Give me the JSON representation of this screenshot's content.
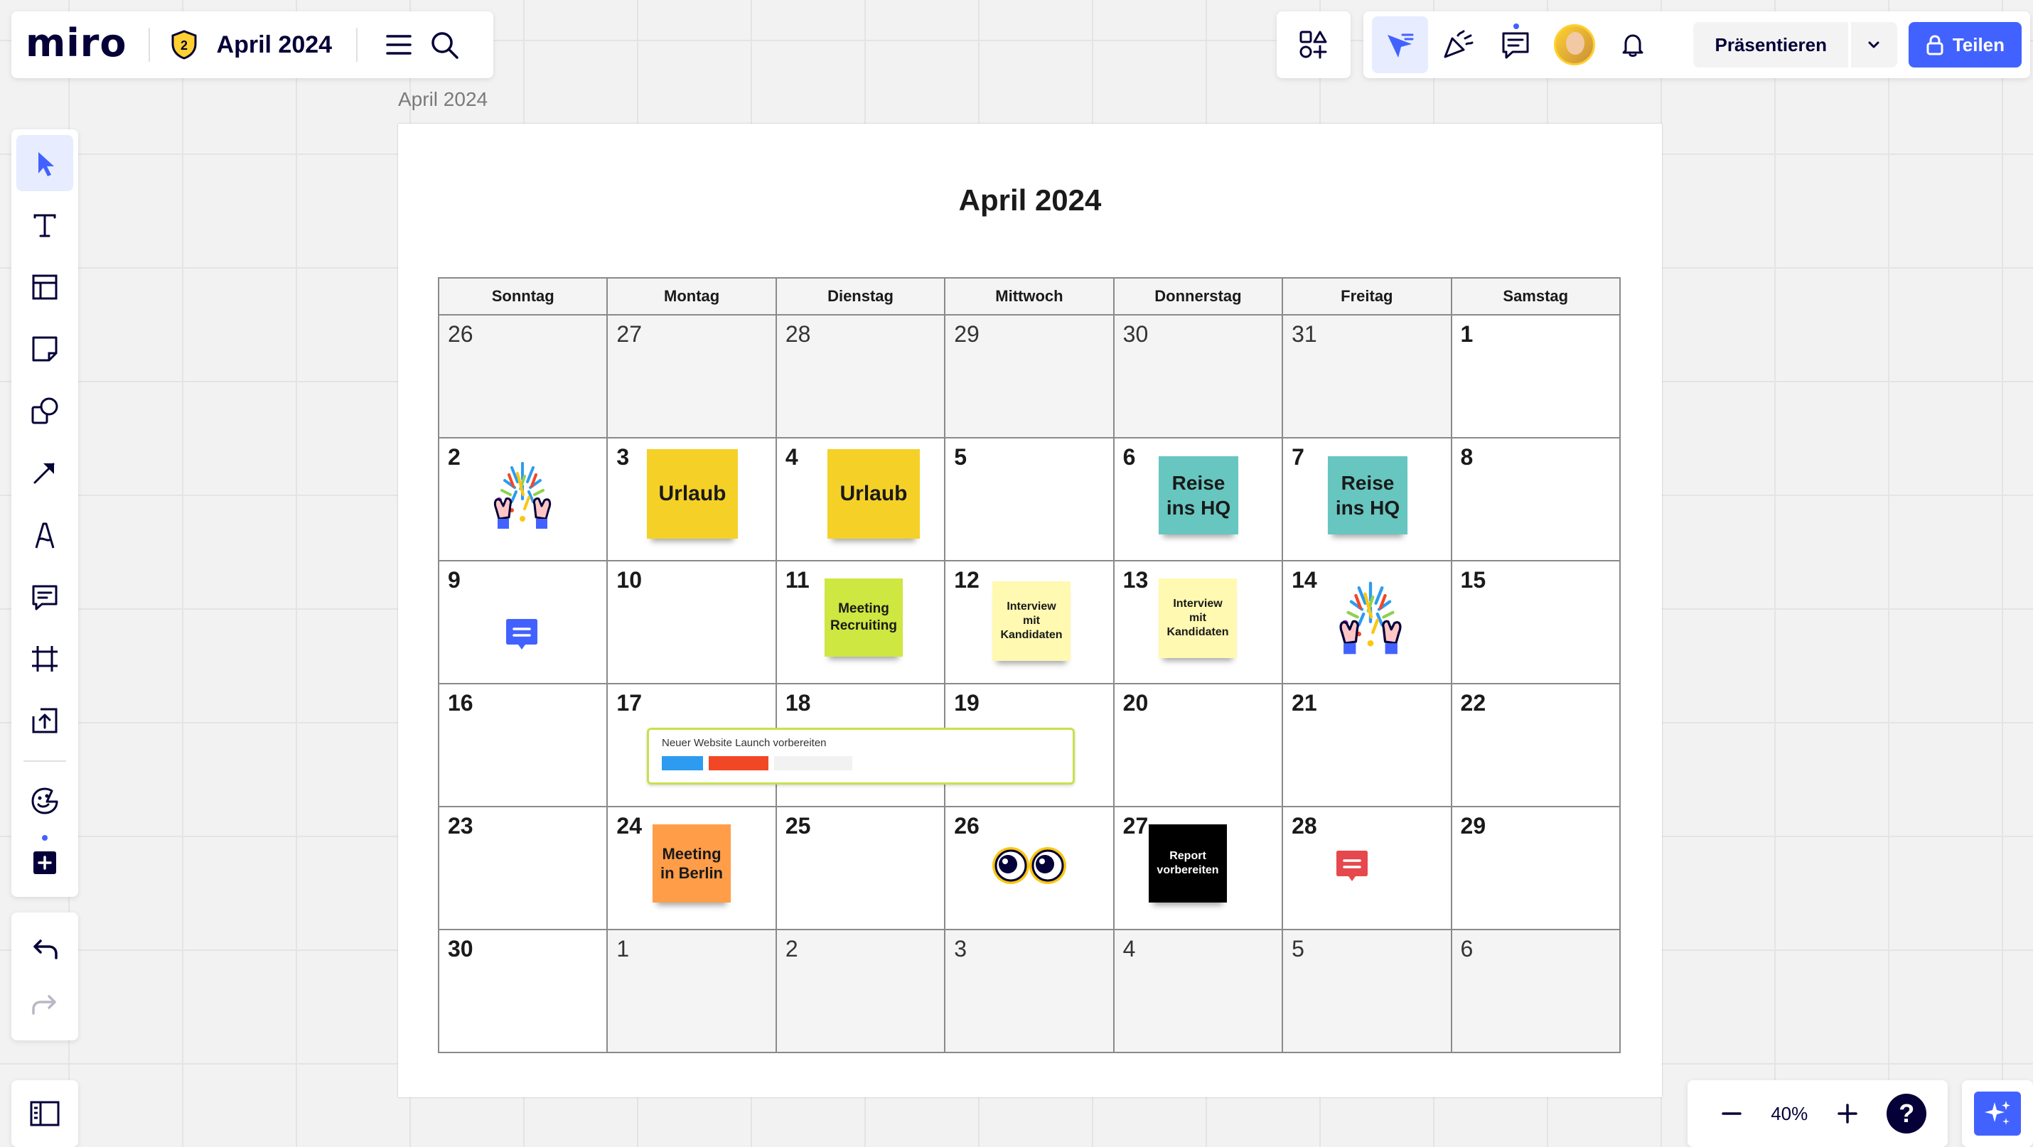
{
  "app": {
    "logo": "miro",
    "board_title": "April 2024",
    "plan_badge": "2"
  },
  "toolbar_right": {
    "present_label": "Präsentieren",
    "share_label": "Teilen"
  },
  "frame": {
    "label": "April 2024",
    "title": "April 2024"
  },
  "calendar": {
    "weekdays": [
      "Sonntag",
      "Montag",
      "Dienstag",
      "Mittwoch",
      "Donnerstag",
      "Freitag",
      "Samstag"
    ],
    "weeks": [
      [
        {
          "n": "26",
          "cur": false
        },
        {
          "n": "27",
          "cur": false
        },
        {
          "n": "28",
          "cur": false
        },
        {
          "n": "29",
          "cur": false
        },
        {
          "n": "30",
          "cur": false
        },
        {
          "n": "31",
          "cur": false
        },
        {
          "n": "1",
          "cur": true
        }
      ],
      [
        {
          "n": "2",
          "cur": true
        },
        {
          "n": "3",
          "cur": true
        },
        {
          "n": "4",
          "cur": true
        },
        {
          "n": "5",
          "cur": true
        },
        {
          "n": "6",
          "cur": true
        },
        {
          "n": "7",
          "cur": true
        },
        {
          "n": "8",
          "cur": true
        }
      ],
      [
        {
          "n": "9",
          "cur": true
        },
        {
          "n": "10",
          "cur": true
        },
        {
          "n": "11",
          "cur": true
        },
        {
          "n": "12",
          "cur": true
        },
        {
          "n": "13",
          "cur": true
        },
        {
          "n": "14",
          "cur": true
        },
        {
          "n": "15",
          "cur": true
        }
      ],
      [
        {
          "n": "16",
          "cur": true
        },
        {
          "n": "17",
          "cur": true
        },
        {
          "n": "18",
          "cur": true
        },
        {
          "n": "19",
          "cur": true
        },
        {
          "n": "20",
          "cur": true
        },
        {
          "n": "21",
          "cur": true
        },
        {
          "n": "22",
          "cur": true
        }
      ],
      [
        {
          "n": "23",
          "cur": true
        },
        {
          "n": "24",
          "cur": true
        },
        {
          "n": "25",
          "cur": true
        },
        {
          "n": "26",
          "cur": true
        },
        {
          "n": "27",
          "cur": true
        },
        {
          "n": "28",
          "cur": true
        },
        {
          "n": "29",
          "cur": true
        }
      ],
      [
        {
          "n": "30",
          "cur": true
        },
        {
          "n": "1",
          "cur": false
        },
        {
          "n": "2",
          "cur": false
        },
        {
          "n": "3",
          "cur": false
        },
        {
          "n": "4",
          "cur": false
        },
        {
          "n": "5",
          "cur": false
        },
        {
          "n": "6",
          "cur": false
        }
      ]
    ]
  },
  "stickies": {
    "urlaub_1": "Urlaub",
    "urlaub_2": "Urlaub",
    "reise_1": "Reise ins HQ",
    "reise_2": "Reise ins HQ",
    "meeting_recruiting": "Meeting Recruiting",
    "interview_1": "Interview mit Kandidaten",
    "interview_2": "Interview mit Kandidaten",
    "meeting_berlin": "Meeting in Berlin",
    "report": "Report vorbereiten"
  },
  "task_card": {
    "title": "Neuer Website Launch vorbereiten",
    "segment_colors": [
      "#2d9bf0",
      "#f24726",
      "#f2f2f2"
    ]
  },
  "zoom": {
    "level": "40%"
  },
  "help": {
    "label": "?"
  },
  "colors": {
    "accent": "#4262ff",
    "sticky_yellow": "#f5d128",
    "sticky_teal": "#67c6c0",
    "sticky_lime": "#cee741",
    "sticky_light_yellow": "#fff9b1",
    "sticky_orange": "#ff9d48",
    "sticky_black": "#000000",
    "comment_blue": "#4262ff",
    "comment_red": "#e6484d"
  }
}
